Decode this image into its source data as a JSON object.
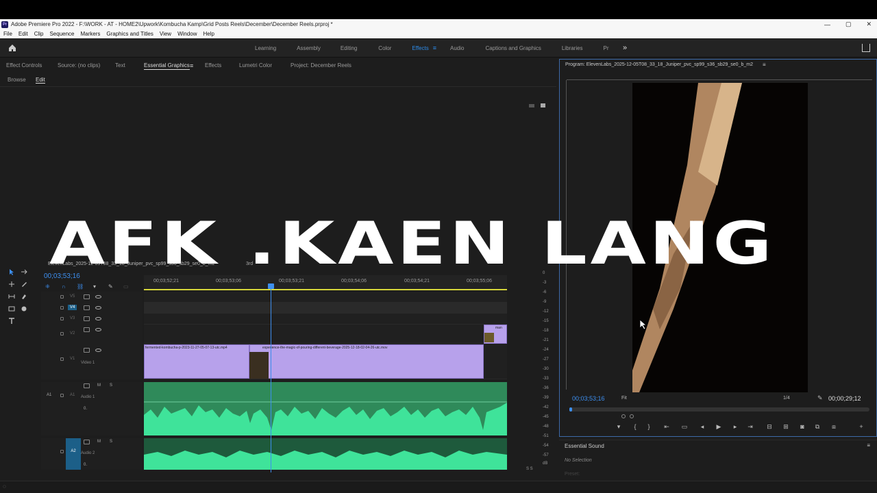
{
  "window": {
    "title": "Adobe Premiere Pro 2022 - F:\\WORK - AT - HOME2\\Upwork\\Kombucha Kamp\\Grid Posts Reels\\December\\December Reels.prproj *",
    "logo": "Pr",
    "minimize": "—",
    "maximize": "▢",
    "close": "✕"
  },
  "menu": [
    "File",
    "Edit",
    "Clip",
    "Sequence",
    "Markers",
    "Graphics and Titles",
    "View",
    "Window",
    "Help"
  ],
  "workspaces": {
    "tabs": [
      "Learning",
      "Assembly",
      "Editing",
      "Color",
      "Effects",
      "Audio",
      "Captions and Graphics",
      "Libraries",
      "Pr"
    ],
    "active": "Effects",
    "more": "»"
  },
  "left_panel": {
    "tabs": [
      "Effect Controls",
      "Source: (no clips)",
      "Text",
      "Essential Graphics",
      "Effects",
      "Lumetri Color",
      "Project: December Reels"
    ],
    "active_tab": "Essential Graphics",
    "subtabs": [
      "Browse",
      "Edit"
    ],
    "active_subtab": "Edit"
  },
  "overlay_text": "AFK .KAEN LANG",
  "timeline": {
    "sequence_tab": "ElevenLabs_2025-12-05T08_33_18_Juniper_pvc_sp99_s36_sb29_se0_b_m2",
    "sequence_tab2": "3rd",
    "timecode": "00;03;53;16",
    "ruler_ticks": [
      "00;03;52;21",
      "00;03;53;06",
      "00;03;53;21",
      "00;03;54;06",
      "00;03;54;21",
      "00;03;55;06"
    ],
    "video_tracks": [
      {
        "id": "V5",
        "label": ""
      },
      {
        "id": "V4",
        "label": ""
      },
      {
        "id": "V3",
        "label": ""
      },
      {
        "id": "V2",
        "label": ""
      },
      {
        "id": "V1",
        "label": "Video 1"
      }
    ],
    "audio_tracks": [
      {
        "id": "A1",
        "label": "Audio 1",
        "level": "0."
      },
      {
        "id": "A2",
        "label": "Audio 2",
        "level": "0."
      }
    ],
    "clips": {
      "v1_a": "fermented-kombucha-p-2023-11-27-05-07-13-utc.mp4",
      "v1_b": "experience-the-magic-of-pouring-different-beverage-2025-12-18-02-04-26-utc.mov",
      "v2": "man"
    },
    "meter_ticks": [
      "0",
      "-3",
      "-6",
      "-9",
      "-12",
      "-15",
      "-18",
      "-21",
      "-24",
      "-27",
      "-30",
      "-33",
      "-36",
      "-39",
      "-42",
      "-45",
      "-48",
      "-51",
      "-54",
      "-57",
      "dB"
    ],
    "meter_solo": "S  S"
  },
  "program": {
    "title": "Program: ElevenLabs_2025-12-05T08_33_18_Juniper_pvc_sp99_s36_sb29_se0_b_m2",
    "timecode": "00;03;53;16",
    "fit": "Fit",
    "ratio": "1/4",
    "duration": "00;00;29;12",
    "playhead_fraction": 0.0
  },
  "essential_sound": {
    "title": "Essential Sound",
    "no_selection": "No Selection",
    "preset": "Preset:"
  },
  "colors": {
    "accent_blue": "#3d8ff0",
    "video_clip": "#b7a1eb",
    "audio_clip": "#2f8a5a",
    "waveform": "#3fe39a",
    "playhead_yellow": "#d6d63a"
  }
}
